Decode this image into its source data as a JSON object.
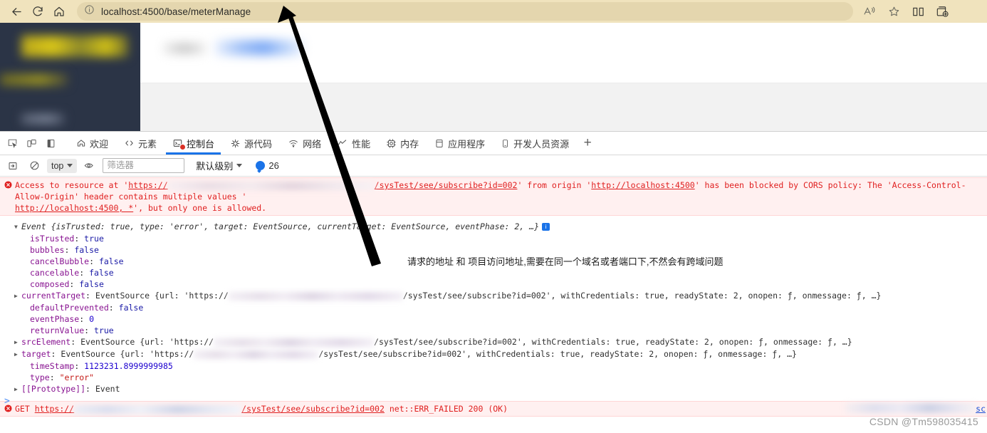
{
  "browser": {
    "back_label": "Back",
    "refresh_label": "Refresh",
    "home_label": "Home",
    "url": "localhost:4500/base/meterManage",
    "read_aloud_label": "Read aloud",
    "favorite_label": "Add to favorites",
    "split_screen_label": "Split screen",
    "collections_label": "Collections"
  },
  "devtools": {
    "inspect_label": "Inspect element",
    "device_label": "Toggle device toolbar",
    "panel_label": "Dock side",
    "tabs": [
      {
        "label": "欢迎",
        "icon": "home-icon",
        "active": false
      },
      {
        "label": "元素",
        "icon": "code-icon",
        "active": false
      },
      {
        "label": "控制台",
        "icon": "console-icon",
        "active": true,
        "error_badge": true
      },
      {
        "label": "源代码",
        "icon": "sources-icon",
        "active": false
      },
      {
        "label": "网络",
        "icon": "network-icon",
        "active": false
      },
      {
        "label": "性能",
        "icon": "performance-icon",
        "active": false
      },
      {
        "label": "内存",
        "icon": "memory-icon",
        "active": false
      },
      {
        "label": "应用程序",
        "icon": "application-icon",
        "active": false
      },
      {
        "label": "开发人员资源",
        "icon": "devresources-icon",
        "active": false
      }
    ],
    "add_tab_label": "+",
    "toolbar": {
      "sidebar_label": "Show console sidebar",
      "clear_label": "Clear console",
      "context": "top",
      "eye_label": "Create live expression",
      "filter_placeholder": "筛选器",
      "levels_label": "默认级别",
      "info_count": "26"
    },
    "prompt": ">"
  },
  "console": {
    "cors_error": {
      "prefix": "Access to resource at '",
      "url_scheme": "https://",
      "url_path": "/sysTest/see/subscribe?id=002",
      "mid": "' from origin '",
      "origin": "http://localhost:4500",
      "suffix": "' has been blocked by CORS policy: The 'Access-Control-Allow-Origin' header contains multiple values '",
      "values": "http://localhost:4500, *",
      "tail": "', but only one is allowed."
    },
    "event": {
      "header": {
        "name": "Event",
        "summary": "{isTrusted: true, type: 'error', target: EventSource, currentTarget: EventSource, eventPhase: 2, …}"
      },
      "props": [
        {
          "name": "isTrusted",
          "value": "true",
          "kind": "kw",
          "expandable": false
        },
        {
          "name": "bubbles",
          "value": "false",
          "kind": "kw",
          "expandable": false
        },
        {
          "name": "cancelBubble",
          "value": "false",
          "kind": "kw",
          "expandable": false
        },
        {
          "name": "cancelable",
          "value": "false",
          "kind": "kw",
          "expandable": false
        },
        {
          "name": "composed",
          "value": "false",
          "kind": "kw",
          "expandable": false
        },
        {
          "name": "currentTarget",
          "value": "EventSource",
          "kind": "obj",
          "expandable": true
        },
        {
          "name": "defaultPrevented",
          "value": "false",
          "kind": "kw",
          "expandable": false
        },
        {
          "name": "eventPhase",
          "value": "0",
          "kind": "num",
          "expandable": false
        },
        {
          "name": "returnValue",
          "value": "true",
          "kind": "kw",
          "expandable": false
        },
        {
          "name": "srcElement",
          "value": "EventSource",
          "kind": "obj",
          "expandable": true
        },
        {
          "name": "target",
          "value": "EventSource",
          "kind": "obj",
          "expandable": true
        },
        {
          "name": "timeStamp",
          "value": "1123231.8999999985",
          "kind": "num",
          "expandable": false
        },
        {
          "name": "type",
          "value": "\"error\"",
          "kind": "str",
          "expandable": false
        },
        {
          "name": "[[Prototype]]",
          "value": "Event",
          "kind": "obj",
          "expandable": true
        }
      ],
      "eventsource_prefix": "EventSource {url: 'https://",
      "eventsource_path": "/sysTest/see/subscribe?id=002',",
      "eventsource_suffix": " withCredentials: true, readyState: 2, onopen: ƒ, onmessage: ƒ, …}"
    },
    "get_error": {
      "method": "GET",
      "url_scheme": "https://",
      "url_path": "/sysTest/see/subscribe?id=002",
      "status": "net::ERR_FAILED 200 (OK)",
      "source_link": "sc"
    }
  },
  "annotation": {
    "text": "请求的地址 和 项目访问地址,需要在同一个域名或者端口下,不然会有跨域问题"
  },
  "watermark": {
    "text": "CSDN @Tm598035415"
  },
  "colors": {
    "chrome_bg": "#f0e3bd",
    "omnibox_bg": "#e4d6ae",
    "page_sidebar": "#2b3446",
    "active_tab_underline": "#1a73e8",
    "error_red": "#e02020",
    "error_bg": "#fff0f0",
    "prop_purple": "#881391",
    "keyword_blue": "#1a1aa6",
    "number_blue": "#1c00cf",
    "string_red": "#c41a16"
  }
}
